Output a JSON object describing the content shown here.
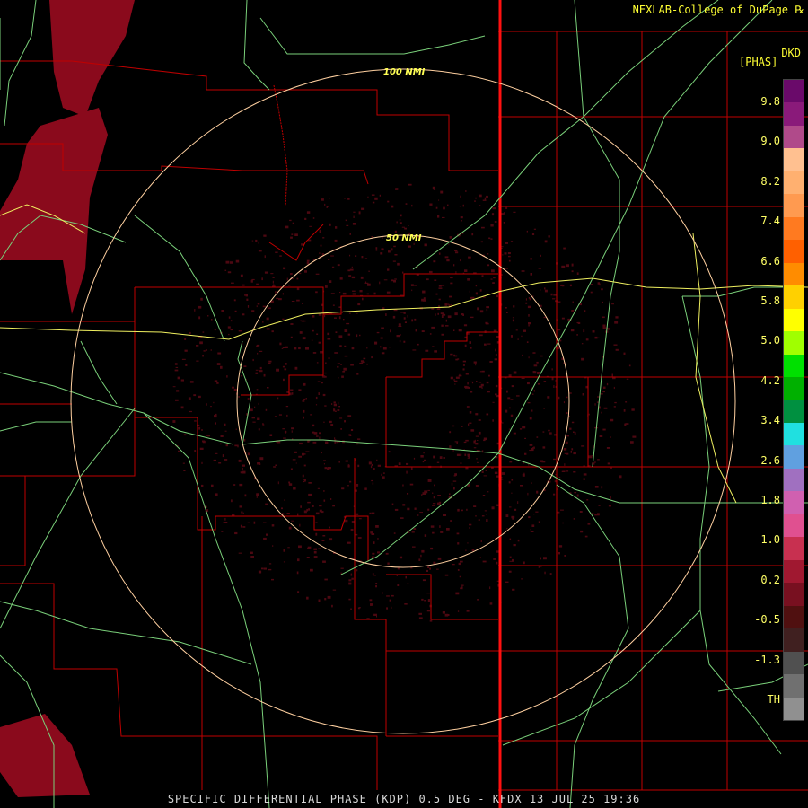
{
  "header": {
    "credit": "NEXLAB-College of DuPage ℞"
  },
  "footer": {
    "caption": "SPECIFIC DIFFERENTIAL PHASE (KDP) 0.5 DEG - KFDX 13 JUL 25 19:36"
  },
  "map": {
    "range_rings": [
      "100 NMI",
      "50 NMI"
    ]
  },
  "legend": {
    "product": "DKD",
    "units": "[PHAS]",
    "ticks": [
      "9.8",
      "9.0",
      "8.2",
      "7.4",
      "6.6",
      "5.8",
      "5.0",
      "4.2",
      "3.4",
      "2.6",
      "1.8",
      "1.0",
      "0.2",
      "-0.5",
      "-1.3",
      "TH"
    ],
    "colors": [
      "#6a0a6a",
      "#8a1a7a",
      "#b04a8a",
      "#ffc090",
      "#ffb070",
      "#ff9a50",
      "#ff7a20",
      "#ff6000",
      "#ff8c00",
      "#ffd000",
      "#ffff00",
      "#a0ff00",
      "#00e000",
      "#00b000",
      "#009040",
      "#20e0e0",
      "#60a0e0",
      "#a070c0",
      "#d060b0",
      "#e05090",
      "#c83050",
      "#a01830",
      "#781020",
      "#501010",
      "#402020",
      "#505050",
      "#707070",
      "#909090"
    ]
  }
}
